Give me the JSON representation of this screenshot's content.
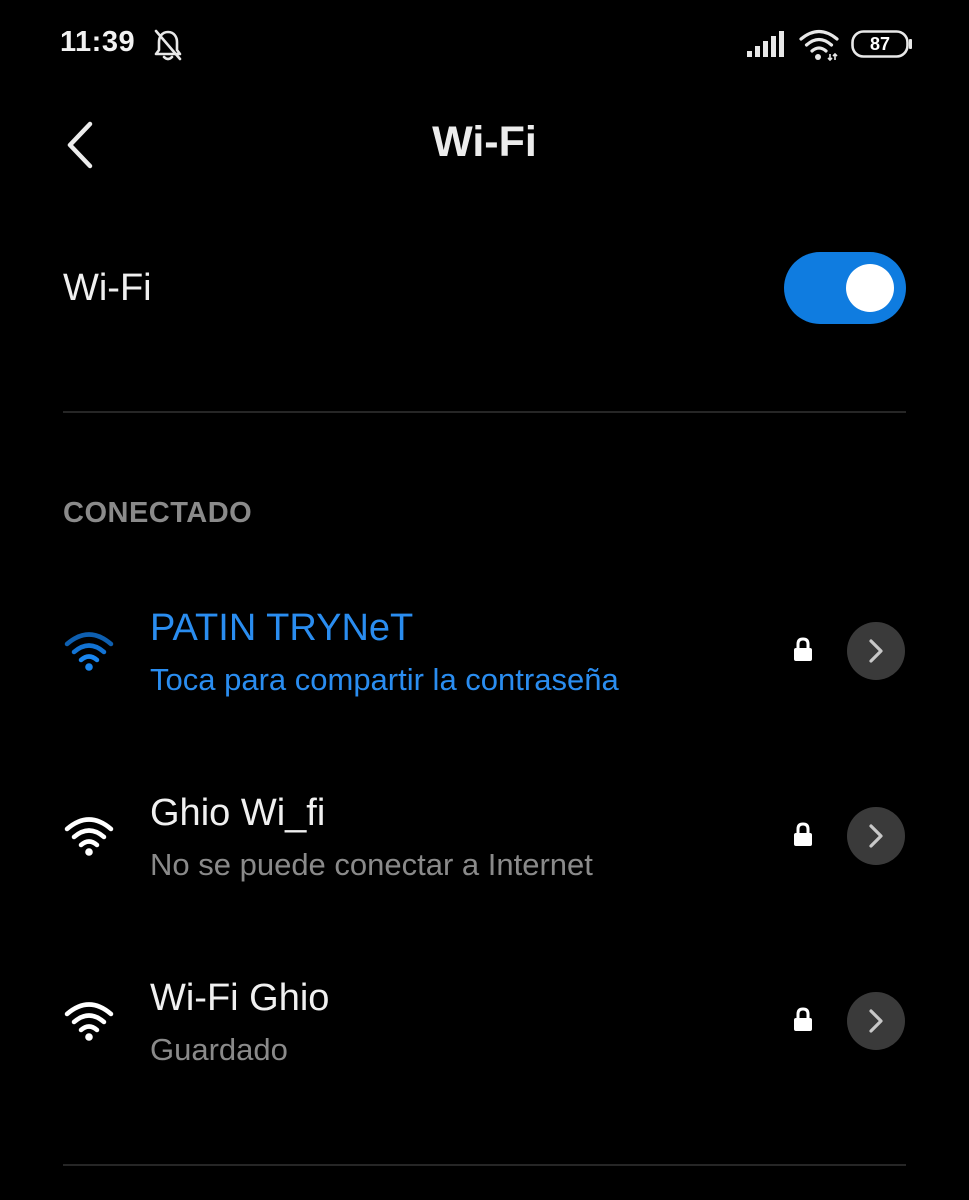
{
  "status_bar": {
    "time": "11:39",
    "battery_level": "87",
    "icons": [
      "bell-off-icon",
      "cellular-signal-icon",
      "wifi-icon",
      "battery-icon"
    ]
  },
  "header": {
    "title": "Wi-Fi",
    "back_icon": "chevron-left-icon"
  },
  "wifi_toggle": {
    "label": "Wi-Fi",
    "enabled": true
  },
  "section": {
    "title": "CONECTADO"
  },
  "networks": [
    {
      "name": "PATIN TRYNeT",
      "status": "Toca para compartir la contraseña",
      "connected": true,
      "secured": true
    },
    {
      "name": "Ghio Wi_fi",
      "status": "No se puede conectar a Internet",
      "connected": false,
      "secured": true
    },
    {
      "name": "Wi-Fi Ghio",
      "status": "Guardado",
      "connected": false,
      "secured": true
    }
  ],
  "colors": {
    "background": "#000000",
    "accent": "#2a8df0",
    "toggle_on": "#0f7ce0",
    "secondary_text": "#8a8a8a"
  }
}
